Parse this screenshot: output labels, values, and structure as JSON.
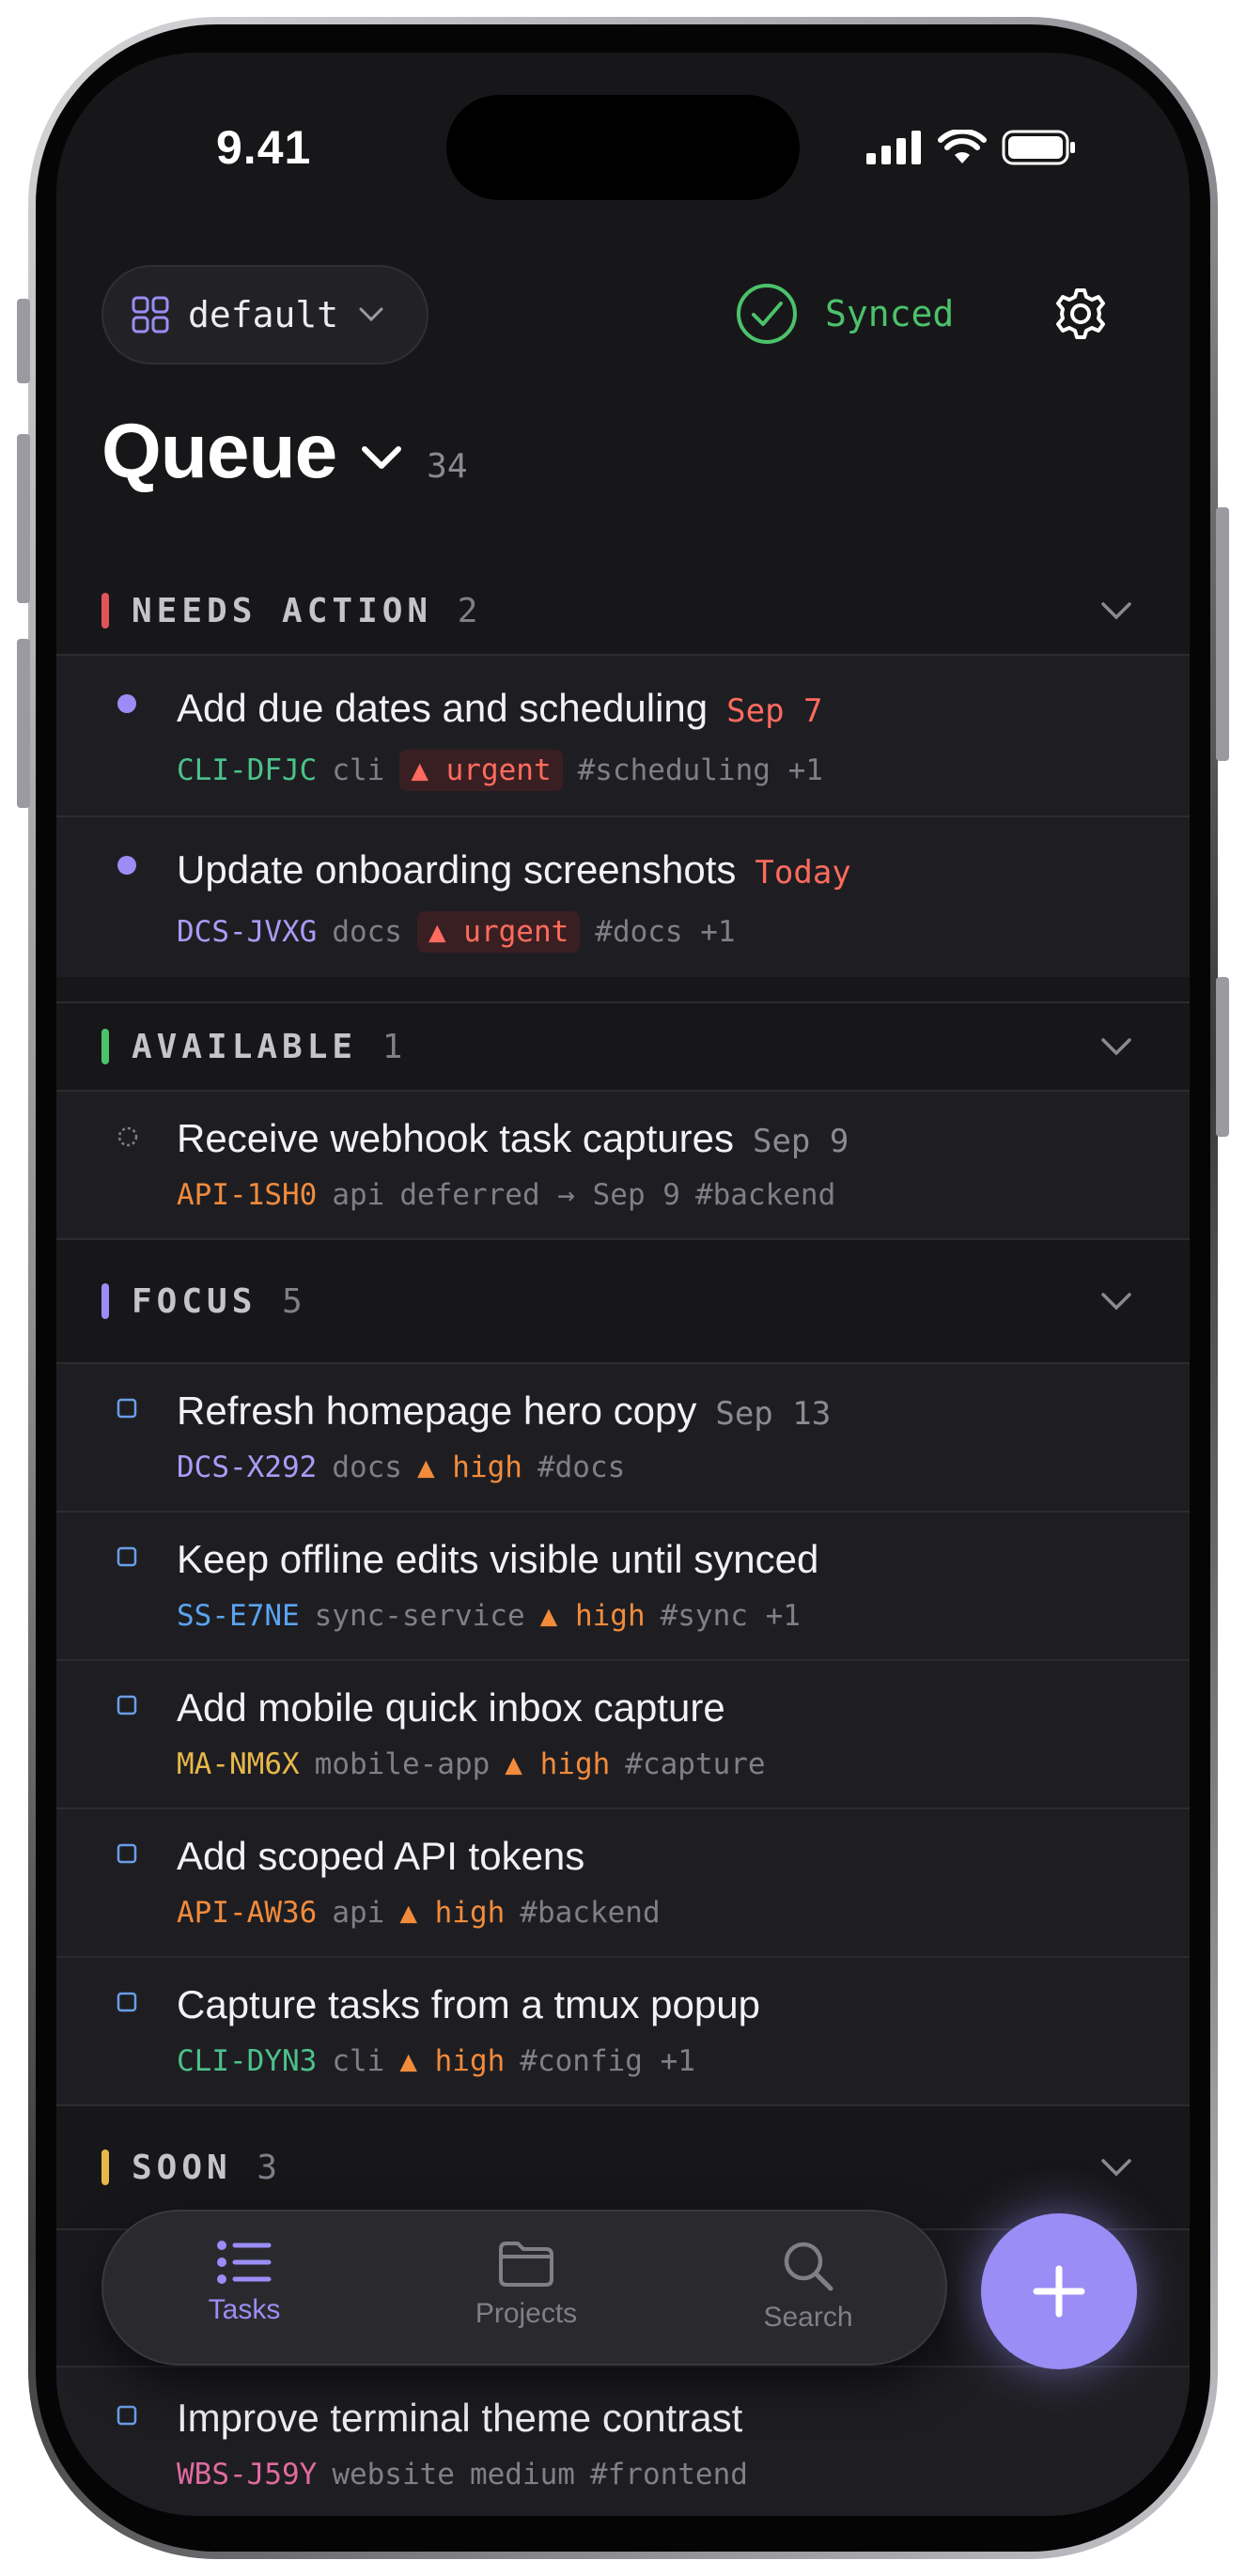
{
  "status_bar": {
    "time": "9.41"
  },
  "header": {
    "workspace_label": "default",
    "sync_label": "Synced"
  },
  "queue": {
    "title": "Queue",
    "count": "34"
  },
  "colors": {
    "accent": "#9b8df5",
    "urgent": "#ff6b5e",
    "high": "#f28b3c",
    "synced": "#4cc26b"
  },
  "sections": [
    {
      "name": "NEEDS ACTION",
      "count": "2",
      "color": "#e0555a"
    },
    {
      "name": "AVAILABLE",
      "count": "1",
      "color": "#4cc26b"
    },
    {
      "name": "FOCUS",
      "count": "5",
      "color": "#9b8df5"
    },
    {
      "name": "SOON",
      "count": "3",
      "color": "#e8b84a"
    }
  ],
  "tasks": [
    {
      "title": "Add due dates and scheduling",
      "due": "Sep 7",
      "id": "CLI-DFJC",
      "project": "cli",
      "priority": "▲ urgent",
      "tags": "#scheduling +1"
    },
    {
      "title": "Update onboarding screenshots",
      "due": "Today",
      "id": "DCS-JVXG",
      "project": "docs",
      "priority": "▲ urgent",
      "tags": "#docs +1"
    },
    {
      "title": "Receive webhook task captures",
      "due": "Sep 9",
      "id": "API-1SH0",
      "project": "api",
      "note": "deferred → Sep 9",
      "tags": "#backend"
    },
    {
      "title": "Refresh homepage hero copy",
      "due": "Sep 13",
      "id": "DCS-X292",
      "project": "docs",
      "priority": "▲ high",
      "tags": "#docs"
    },
    {
      "title": "Keep offline edits visible until synced",
      "id": "SS-E7NE",
      "project": "sync-service",
      "priority": "▲ high",
      "tags": "#sync +1"
    },
    {
      "title": "Add mobile quick inbox capture",
      "id": "MA-NM6X",
      "project": "mobile-app",
      "priority": "▲ high",
      "tags": "#capture"
    },
    {
      "title": "Add scoped API tokens",
      "id": "API-AW36",
      "project": "api",
      "priority": "▲ high",
      "tags": "#backend"
    },
    {
      "title": "Capture tasks from a tmux popup",
      "id": "CLI-DYN3",
      "project": "cli",
      "priority": "▲ high",
      "tags": "#config +1"
    },
    {
      "title": "Improve terminal theme contrast",
      "id": "WBS-J59Y",
      "project": "website",
      "priority": "medium",
      "tags": "#frontend"
    }
  ],
  "tabbar": {
    "tasks_label": "Tasks",
    "projects_label": "Projects",
    "search_label": "Search"
  }
}
